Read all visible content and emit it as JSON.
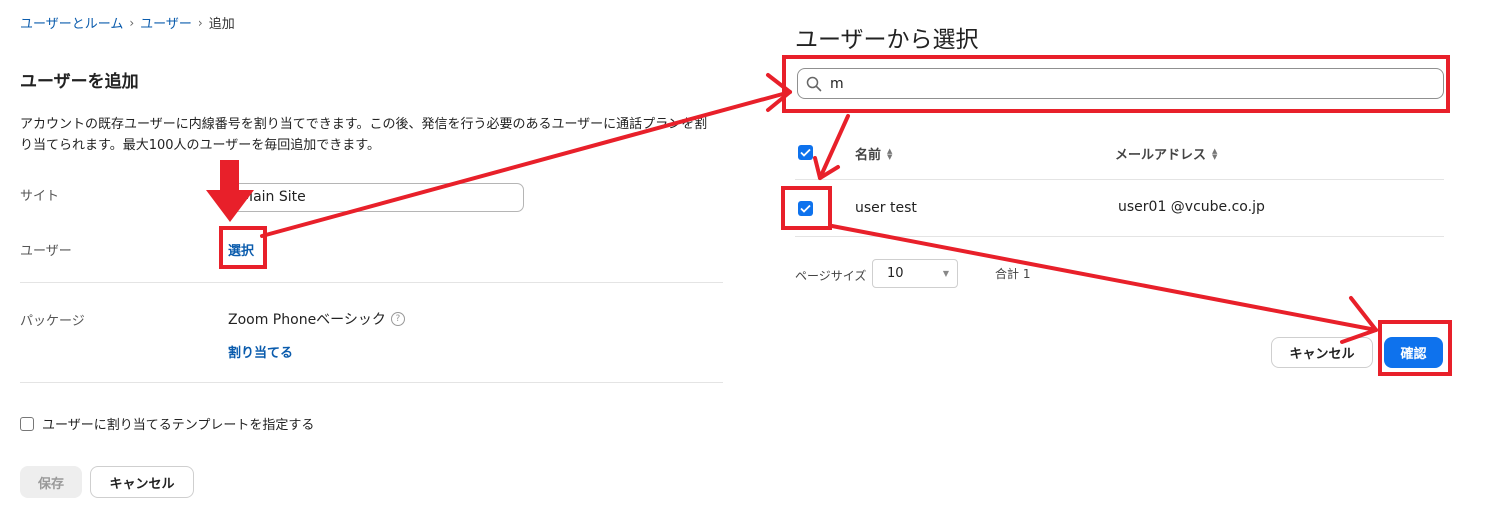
{
  "breadcrumb": {
    "item1": "ユーザーとルーム",
    "item2": "ユーザー",
    "current": "追加",
    "separator": "›"
  },
  "page": {
    "title": "ユーザーを追加",
    "description": "アカウントの既存ユーザーに内線番号を割り当てできます。この後、発信を行う必要のあるユーザーに通話プランを割り当てられます。最大100人のユーザーを毎回追加できます。"
  },
  "form": {
    "site_label": "サイト",
    "site_value": "Main Site",
    "user_label": "ユーザー",
    "user_select_link": "選択",
    "package_label": "パッケージ",
    "package_value": "Zoom Phoneベーシック",
    "help_glyph": "?",
    "assign_link": "割り当てる",
    "template_checkbox_label": "ユーザーに割り当てるテンプレートを指定する",
    "save_button": "保存",
    "cancel_button": "キャンセル"
  },
  "dialog": {
    "title": "ユーザーから選択",
    "search_value": "m",
    "columns": [
      "名前",
      "メールアドレス"
    ],
    "rows": [
      {
        "name": "user test",
        "email": "user01 @vcube.co.jp",
        "checked": true
      }
    ],
    "page_size_label": "ページサイズ",
    "page_size_value": "10",
    "total_label": "合計 1",
    "cancel_button": "キャンセル",
    "confirm_button": "確認"
  },
  "colors": {
    "link": "#0b5cad",
    "primary": "#0e72ed",
    "annotation_red": "#e8202a"
  },
  "icons": {
    "search": "search-icon",
    "checkbox": "checkmark-icon",
    "sort": "sort-icon",
    "dropdown": "chevron-down-icon",
    "help": "question-circle-icon"
  }
}
